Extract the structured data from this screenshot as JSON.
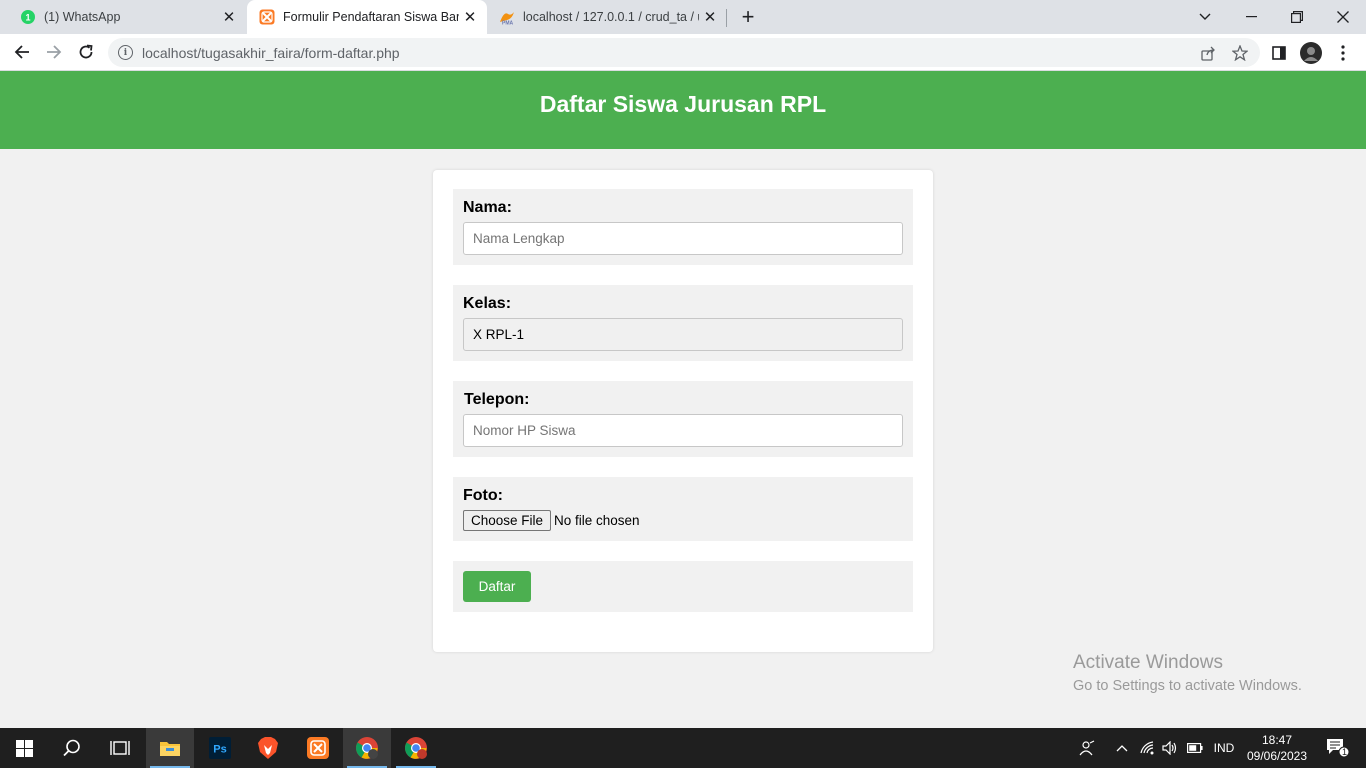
{
  "browser": {
    "tabs": [
      {
        "title": "(1) WhatsApp",
        "active": false
      },
      {
        "title": "Formulir Pendaftaran Siswa Baru",
        "active": true
      },
      {
        "title": "localhost / 127.0.0.1 / crud_ta / u",
        "active": false
      }
    ],
    "url": "localhost/tugasakhir_faira/form-daftar.php"
  },
  "page": {
    "title": "Daftar Siswa Jurusan RPL",
    "form": {
      "nama": {
        "label": "Nama:",
        "placeholder": "Nama Lengkap"
      },
      "kelas": {
        "label": "Kelas:",
        "value": "X RPL-1"
      },
      "telepon": {
        "label": "Telepon:",
        "placeholder": "Nomor HP Siswa"
      },
      "foto": {
        "label": "Foto:",
        "button": "Choose File",
        "status": "No file chosen"
      },
      "submit_label": "Daftar"
    }
  },
  "watermark": {
    "line1": "Activate Windows",
    "line2": "Go to Settings to activate Windows."
  },
  "taskbar": {
    "language": "IND",
    "time": "18:47",
    "date": "09/06/2023",
    "notification_count": "1"
  },
  "colors": {
    "header": "#4caf50",
    "button": "#4caf50",
    "page_bg": "#f1f1f1"
  }
}
